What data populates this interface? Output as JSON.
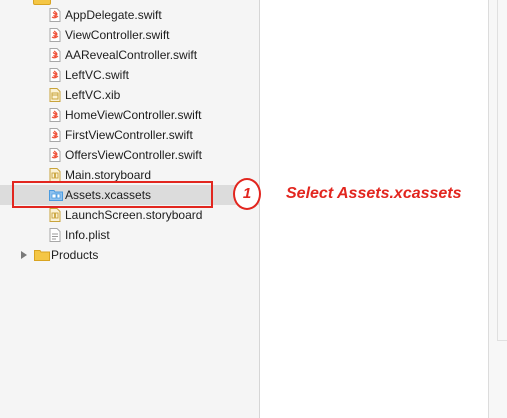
{
  "file_navigator": {
    "items": [
      {
        "label": "AppDelegate.swift",
        "icon": "swift-file-icon"
      },
      {
        "label": "ViewController.swift",
        "icon": "swift-file-icon"
      },
      {
        "label": "AARevealController.swift",
        "icon": "swift-file-icon"
      },
      {
        "label": "LeftVC.swift",
        "icon": "swift-file-icon"
      },
      {
        "label": "LeftVC.xib",
        "icon": "xib-file-icon"
      },
      {
        "label": "HomeViewController.swift",
        "icon": "swift-file-icon"
      },
      {
        "label": "FirstViewController.swift",
        "icon": "swift-file-icon"
      },
      {
        "label": "OffersViewController.swift",
        "icon": "swift-file-icon"
      },
      {
        "label": "Main.storyboard",
        "icon": "storyboard-file-icon"
      },
      {
        "label": "Assets.xcassets",
        "icon": "asset-catalog-icon",
        "selected": true
      },
      {
        "label": "LaunchScreen.storyboard",
        "icon": "storyboard-file-icon"
      },
      {
        "label": "Info.plist",
        "icon": "plist-file-icon"
      }
    ],
    "products_group": {
      "label": "Products",
      "icon": "folder-icon",
      "expanded": false
    }
  },
  "annotation": {
    "step_number": "1",
    "instruction": "Select Assets.xcassets",
    "color": "#e2261f"
  },
  "colors": {
    "navigator_bg": "#f5f5f5",
    "selected_row_bg": "#dcdcdc",
    "swift_icon": "#f05138",
    "folder_yellow": "#f4c645",
    "asset_blue": "#4a9be0"
  }
}
